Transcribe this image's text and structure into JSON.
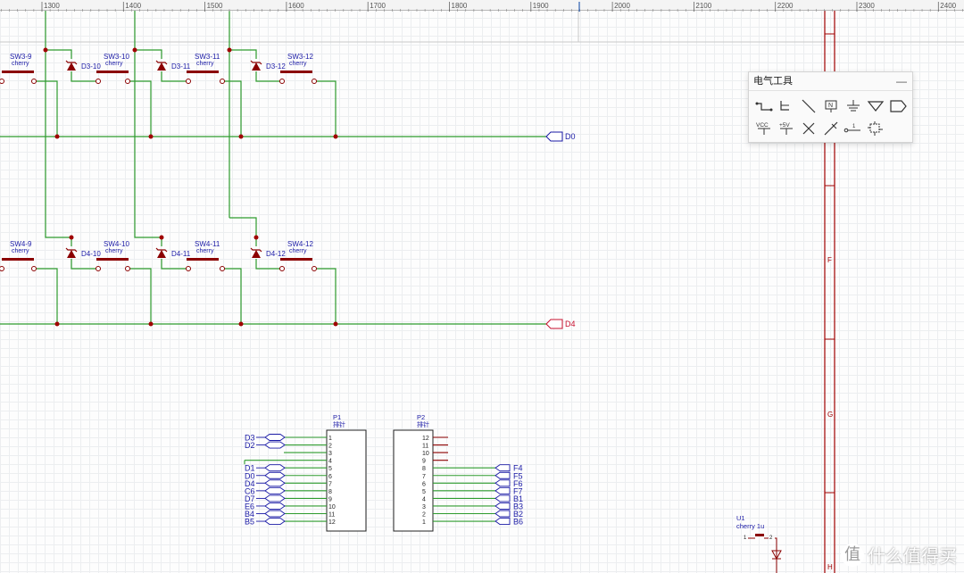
{
  "ruler": {
    "ticks": [
      "1300",
      "1400",
      "1500",
      "1600",
      "1700",
      "1800",
      "1900",
      "2000",
      "2100",
      "2200",
      "2300",
      "2400"
    ]
  },
  "toolbox": {
    "title": "电气工具",
    "minimize": "—",
    "tools": [
      {
        "name": "wire-tool"
      },
      {
        "name": "bus-entry-tool"
      },
      {
        "name": "line-tool"
      },
      {
        "name": "net-label-tool",
        "label": "N"
      },
      {
        "name": "ground-tool"
      },
      {
        "name": "power-triangle-tool"
      },
      {
        "name": "net-port-tool"
      },
      {
        "name": "vcc-tool",
        "label": "VCC"
      },
      {
        "name": "plus5v-tool",
        "label": "+5V"
      },
      {
        "name": "no-connect-tool"
      },
      {
        "name": "probe-tool"
      },
      {
        "name": "pin-tool",
        "label": "1"
      },
      {
        "name": "select-tool"
      }
    ]
  },
  "schematic": {
    "top_row": {
      "switches": [
        "SW3-9",
        "SW3-10",
        "SW3-11",
        "SW3-12"
      ],
      "diodes": [
        "D3-10",
        "D3-11",
        "D3-12"
      ],
      "net_label": "D0"
    },
    "bottom_row": {
      "switches": [
        "SW4-9",
        "SW4-10",
        "SW4-11",
        "SW4-12"
      ],
      "diodes": [
        "D4-10",
        "D4-11",
        "D4-12"
      ],
      "net_label": "D4"
    },
    "switch_value": "cherry",
    "headers": {
      "p1": {
        "ref": "P1",
        "value": "排针",
        "pins": [
          "1",
          "2",
          "3",
          "4",
          "5",
          "6",
          "7",
          "8",
          "9",
          "10",
          "11",
          "12"
        ],
        "nets": [
          "D3",
          "D2",
          "",
          "",
          "D1",
          "D0",
          "D4",
          "C6",
          "D7",
          "E6",
          "B4",
          "B5"
        ]
      },
      "p2": {
        "ref": "P2",
        "value": "排针",
        "pins": [
          "12",
          "11",
          "10",
          "9",
          "8",
          "7",
          "6",
          "5",
          "4",
          "3",
          "2",
          "1"
        ],
        "nets": [
          "",
          "",
          "",
          "",
          "F4",
          "F5",
          "F6",
          "F7",
          "B1",
          "B3",
          "B2",
          "B6"
        ]
      }
    },
    "bus_labels": [
      "F",
      "G",
      "H"
    ],
    "u1": {
      "ref": "U1",
      "value": "cherry 1u",
      "pin1": "1",
      "pin2": "2"
    }
  },
  "watermark": "什么值得买",
  "colors": {
    "wire": "#2e9b2e",
    "component": "#8b0000",
    "net_label": "#1a1aa6",
    "junction": "#a00000",
    "bus": "#a00000"
  }
}
